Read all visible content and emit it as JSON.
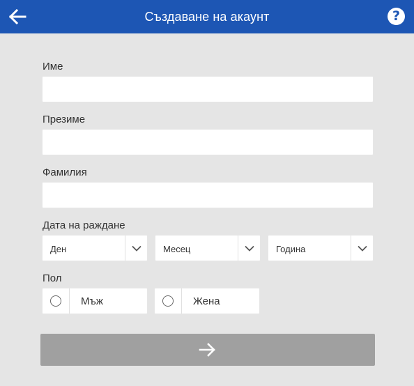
{
  "header": {
    "title": "Създаване на акаунт",
    "back_icon": "arrow-left-icon",
    "help_icon": "question-icon",
    "help_glyph": "?",
    "background_color": "#1d56b4"
  },
  "form": {
    "first_name": {
      "label": "Име",
      "value": ""
    },
    "middle_name": {
      "label": "Презиме",
      "value": ""
    },
    "last_name": {
      "label": "Фамилия",
      "value": ""
    },
    "birth_date": {
      "label": "Дата на раждане",
      "day": {
        "selected": "Ден",
        "icon": "chevron-down-icon"
      },
      "month": {
        "selected": "Месец",
        "icon": "chevron-down-icon"
      },
      "year": {
        "selected": "Година",
        "icon": "chevron-down-icon"
      }
    },
    "gender": {
      "label": "Пол",
      "options": [
        {
          "label": "Мъж",
          "selected": false
        },
        {
          "label": "Жена",
          "selected": false
        }
      ]
    }
  },
  "submit": {
    "icon": "arrow-right-icon",
    "background_color": "#a0a0a0"
  }
}
